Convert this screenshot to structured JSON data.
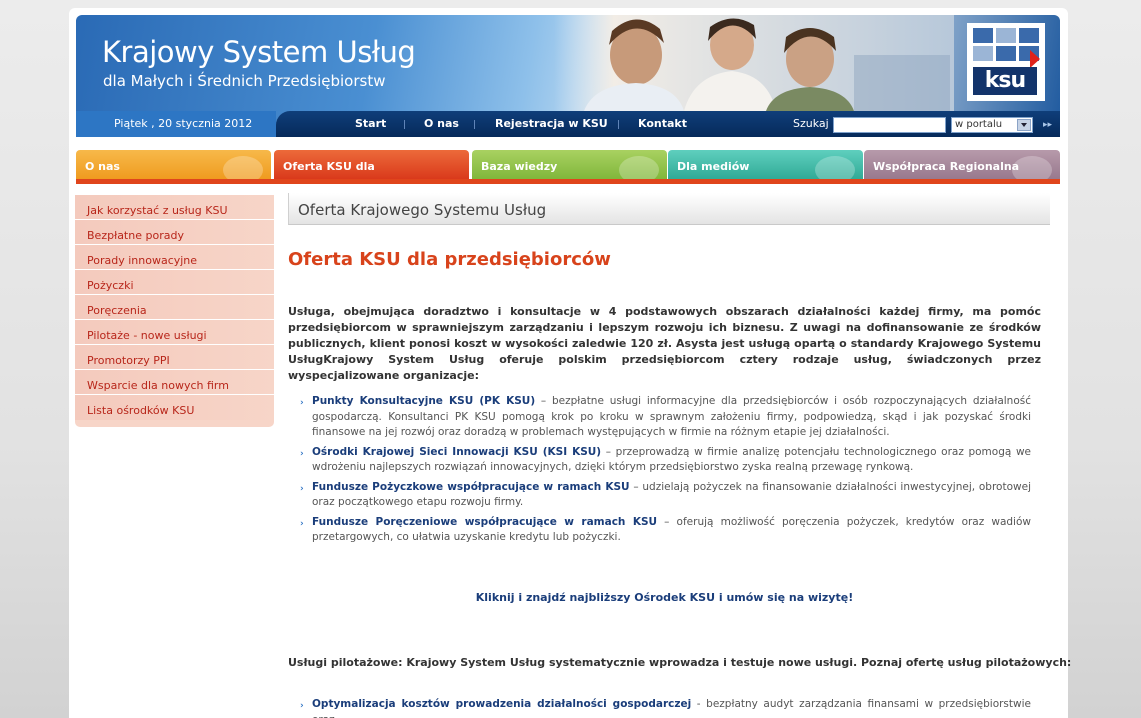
{
  "header": {
    "title": "Krajowy System Usług",
    "subtitle": "dla Małych i Średnich Przedsiębiorstw",
    "logo_text": "ksu",
    "date": "Piątek , 20 stycznia  2012"
  },
  "topnav": {
    "items": [
      "Start",
      "O nas",
      "Rejestracja w KSU",
      "Kontakt"
    ],
    "search_label": "Szukaj",
    "search_value": "",
    "search_scope": "w portalu"
  },
  "tabs": [
    {
      "label": "O nas",
      "color": "#f2a32a"
    },
    {
      "label": "Oferta KSU dla przedsiębiorców",
      "color": "#e0451c"
    },
    {
      "label": "Baza wiedzy",
      "color": "#8cc043"
    },
    {
      "label": "Dla mediów",
      "color": "#3fb7a6"
    },
    {
      "label": "Współpraca Regionalna",
      "color": "#a8879c"
    }
  ],
  "sidebar": {
    "items": [
      "Jak korzystać z usług KSU",
      "Bezpłatne porady",
      "Porady innowacyjne",
      "Pożyczki",
      "Poręczenia",
      "Pilotaże - nowe usługi",
      "Promotorzy PPI",
      "Wsparcie dla nowych firm",
      "Lista ośrodków KSU"
    ]
  },
  "main": {
    "section_title": "Oferta Krajowego Systemu Usług",
    "heading": "Oferta KSU dla przedsiębiorców",
    "intro": "Usługa, obejmująca doradztwo i konsultacje w 4 podstawowych obszarach działalności każdej firmy, ma pomóc przedsiębiorcom w sprawniejszym zarządzaniu i lepszym rozwoju ich biznesu. Z uwagi na dofinansowanie ze środków publicznych, klient ponosi koszt w wysokości zaledwie 120 zł. Asysta jest usługą opartą o standardy Krajowego Systemu UsługKrajowy System Usług oferuje polskim przedsiębiorcom cztery rodzaje usług, świadczonych przez wyspecjalizowane organizacje:",
    "services": [
      {
        "name": "Punkty Konsultacyjne KSU (PK KSU)",
        "text": " – bezpłatne usługi informacyjne dla przedsiębiorców i osób rozpoczynających działalność gospodarczą. Konsultanci PK KSU pomogą krok po kroku w sprawnym założeniu firmy, podpowiedzą, skąd i jak pozyskać środki finansowe na jej rozwój oraz doradzą w problemach występujących w firmie na różnym etapie jej działalności."
      },
      {
        "name": "Ośrodki Krajowej Sieci Innowacji KSU (KSI KSU)",
        "text": " – przeprowadzą w firmie analizę potencjału technologicznego oraz pomogą we wdrożeniu najlepszych rozwiązań innowacyjnych, dzięki którym przedsiębiorstwo zyska realną przewagę rynkową."
      },
      {
        "name": "Fundusze Pożyczkowe współpracujące w ramach KSU",
        "text": " – udzielają pożyczek na finansowanie działalności inwestycyjnej, obrotowej oraz początkowego etapu rozwoju firmy."
      },
      {
        "name": "Fundusze Poręczeniowe współpracujące w ramach KSU",
        "text": " – oferują możliwość poręczenia pożyczek, kredytów oraz wadiów przetargowych, co ułatwia uzyskanie kredytu lub pożyczki."
      }
    ],
    "cta": "Kliknij i znajdź najbliższy Ośrodek KSU i umów się na wizytę!",
    "pilot_intro": "Usługi pilotażowe: Krajowy System Usług systematycznie wprowadza i testuje nowe usługi. Poznaj ofertę usług pilotażowych:",
    "pilot_services": [
      {
        "name": "Optymalizacja kosztów prowadzenia działalności gospodarczej",
        "text": " - bezpłatny audyt zarządzania finansami w przedsiębiorstwie oraz"
      }
    ]
  }
}
